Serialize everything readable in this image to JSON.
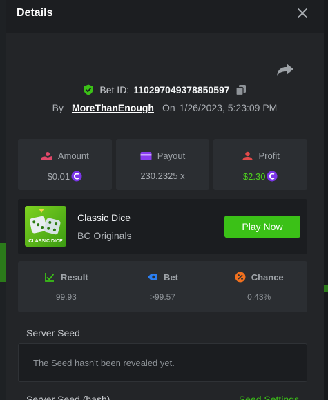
{
  "modal": {
    "title": "Details"
  },
  "bet": {
    "id_label": "Bet ID:",
    "id_value": "110297049378850597",
    "by_label": "By",
    "username": "MoreThanEnough",
    "on_label": "On",
    "datetime": "1/26/2023, 5:23:09 PM"
  },
  "stats": {
    "amount_label": "Amount",
    "amount_value": "$0.01",
    "payout_label": "Payout",
    "payout_value": "230.2325 x",
    "profit_label": "Profit",
    "profit_value": "$2.30"
  },
  "game": {
    "name": "Classic Dice",
    "provider": "BC Originals",
    "thumb_text": "CLASSIC DICE",
    "play_label": "Play Now"
  },
  "result": {
    "result_label": "Result",
    "result_value": "99.93",
    "bet_label": "Bet",
    "bet_value": ">99.57",
    "chance_label": "Chance",
    "chance_value": "0.43%"
  },
  "seed": {
    "server_seed_title": "Server Seed",
    "server_seed_message": "The Seed hasn't been revealed yet.",
    "hash_title": "Server Seed (hash)",
    "settings_link": "Seed Settings"
  },
  "icons": [
    "close-icon",
    "share-icon",
    "shield-check-icon",
    "copy-icon",
    "amount-icon",
    "payout-icon",
    "profit-icon",
    "coin-icon",
    "result-icon",
    "bet-icon",
    "chance-icon"
  ],
  "colors": {
    "accent_green": "#3bc117",
    "profit_green": "#4ed11f",
    "coin_purple": "#7b35e8",
    "amount_pink": "#e2486a",
    "payout_purple": "#8a3cf0",
    "profit_red": "#e24a4a",
    "bet_blue": "#2b7ff2",
    "chance_orange": "#f0701e"
  }
}
